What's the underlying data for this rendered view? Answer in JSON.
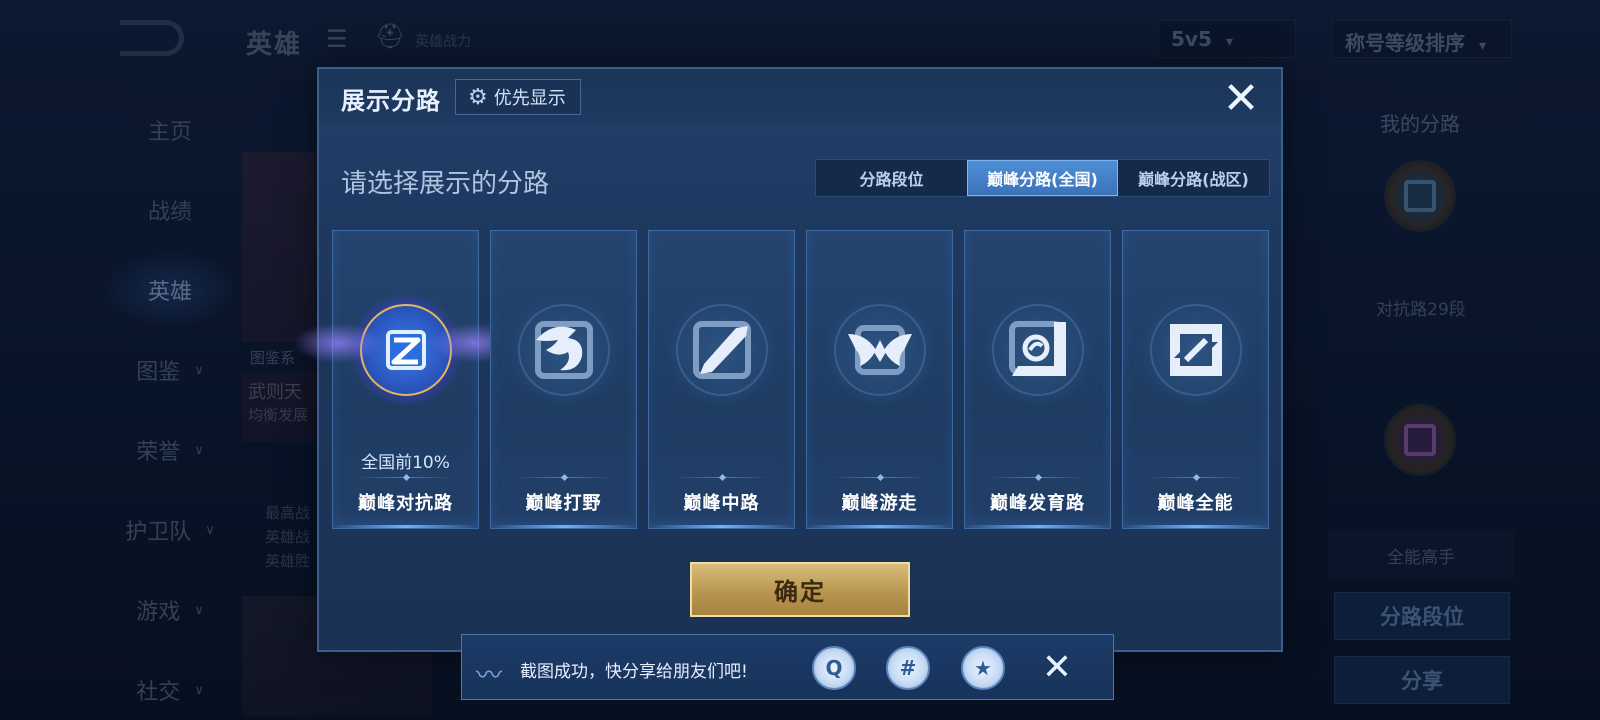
{
  "background": {
    "header_title": "英雄",
    "header_subtitle": "英雄战力",
    "mode_dropdown": "5v5",
    "sort_dropdown": "称号等级排序",
    "nav": [
      {
        "label": "主页",
        "has_chevron": false
      },
      {
        "label": "战绩",
        "has_chevron": false
      },
      {
        "label": "英雄",
        "has_chevron": false,
        "active": true
      },
      {
        "label": "图鉴",
        "has_chevron": true
      },
      {
        "label": "荣誉",
        "has_chevron": true
      },
      {
        "label": "护卫队",
        "has_chevron": true
      },
      {
        "label": "游戏",
        "has_chevron": true
      },
      {
        "label": "社交",
        "has_chevron": true
      }
    ],
    "card_tag": "图鉴系",
    "hero_name": "武则天",
    "hero_style": "均衡发展",
    "stats": [
      "最高战",
      "英雄战",
      "英雄胜"
    ],
    "right_panel": {
      "title": "我的分路",
      "lane1": "对抗路29段",
      "lane2": "全能高手",
      "btn_lane_rank": "分路段位",
      "btn_share": "分享"
    }
  },
  "modal": {
    "title": "展示分路",
    "priority_button": "优先显示",
    "prompt": "请选择展示的分路",
    "tabs": [
      {
        "label": "分路段位",
        "selected": false
      },
      {
        "label": "巅峰分路(全国)",
        "selected": true
      },
      {
        "label": "巅峰分路(战区)",
        "selected": false
      }
    ],
    "lanes": [
      {
        "label": "巅峰对抗路",
        "rank": "全国前10%",
        "selected": true,
        "icon": "clash-lane-icon"
      },
      {
        "label": "巅峰打野",
        "rank": "",
        "selected": false,
        "icon": "jungle-dragon-icon"
      },
      {
        "label": "巅峰中路",
        "rank": "",
        "selected": false,
        "icon": "mid-lane-icon"
      },
      {
        "label": "巅峰游走",
        "rank": "",
        "selected": false,
        "icon": "roam-wings-icon"
      },
      {
        "label": "巅峰发育路",
        "rank": "",
        "selected": false,
        "icon": "farm-lane-icon"
      },
      {
        "label": "巅峰全能",
        "rank": "",
        "selected": false,
        "icon": "all-round-icon"
      }
    ],
    "confirm": "确定"
  },
  "toast": {
    "message": "截图成功，快分享给朋友们吧!",
    "share_targets": [
      "qq-icon",
      "wechat-icon",
      "qzone-icon"
    ]
  },
  "colors": {
    "accent_gold": "#c9a961",
    "tab_selected": "#4685cf",
    "modal_bg": "#1f3a62"
  }
}
